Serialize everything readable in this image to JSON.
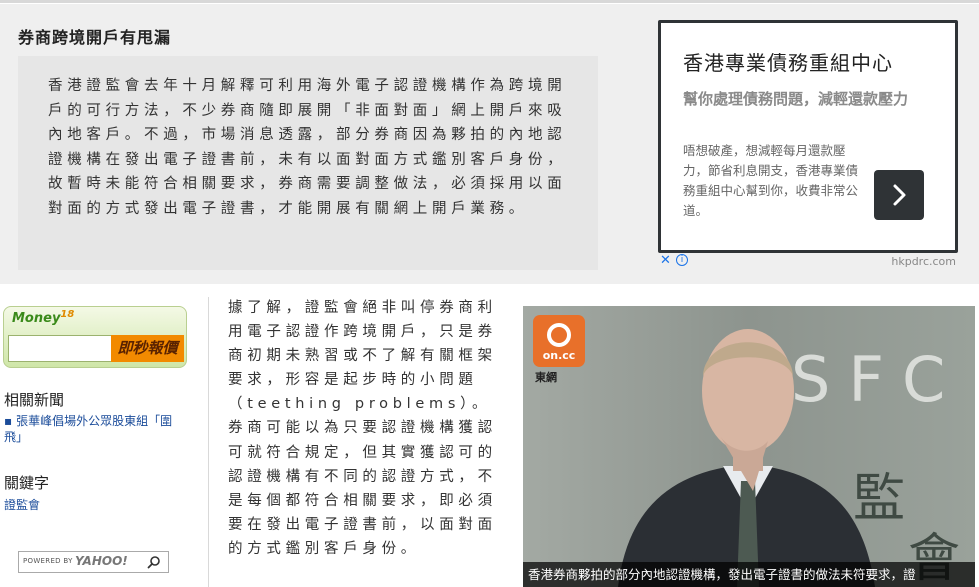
{
  "article": {
    "title": "券商跨境開戶有甩漏",
    "lead": "香港證監會去年十月解釋可利用海外電子認證機構作為跨境開戶的可行方法，不少券商隨即展開「非面對面」網上開戶來吸內地客戶。不過，市場消息透露，部分券商因為夥拍的內地認證機構在發出電子證書前，未有以面對面方式鑑別客戶身份，故暫時未能符合相關要求，券商需要調整做法，必須採用以面對面的方式發出電子證書，才能開展有關網上開戶業務。",
    "body": "據了解，證監會絕非叫停券商利用電子認證作跨境開戶，只是券商初期未熟習或不了解有關框架要求，形容是起步時的小問題（teething problems）。券商可能以為只要認證機構獲認可就符合規定，但其實獲認可的認證機構有不同的認證方式，不是每個都符合相關要求，即必須要在發出電子證書前，以面對面的方式鑑別客戶身份。"
  },
  "ad": {
    "title": "香港專業債務重組中心",
    "subtitle": "幫你處理債務問題，減輕還款壓力",
    "description": "唔想破產，想減輕每月還款壓力，節省利息開支，香港專業債務重組中心幫到你，收費非常公道。",
    "close_glyph": "✕",
    "info_glyph": "i",
    "domain": "hkpdrc.com",
    "arrow_icon": "chevron-right-icon"
  },
  "sidebar": {
    "money_logo": "Money",
    "money_logo_num": "18",
    "quote_button": "即秒報價",
    "related_heading": "相關新聞",
    "related_items": [
      "張華峰倡場外公眾股東組「圍飛」"
    ],
    "keywords_heading": "關鍵字",
    "keywords": [
      "證監會"
    ],
    "search": {
      "placeholder": "POWERED BY",
      "brand": "YAHOO!",
      "icon": "search-icon"
    }
  },
  "photo": {
    "logo_text": "on.cc",
    "logo_label": "東網",
    "caption": "香港券商夥拍的部分內地認證機構，發出電子證書的做法未符要求，證"
  },
  "colors": {
    "band": "#efefef",
    "lead_box": "#e6e6e6",
    "ad_border": "#2f3336",
    "link": "#1b4c9a",
    "quote_button": "#f28a00",
    "oncc": "#e8702a"
  }
}
